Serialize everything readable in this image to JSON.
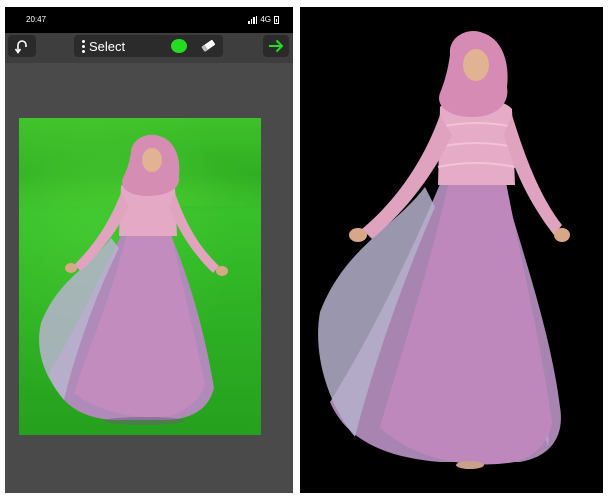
{
  "status_bar": {
    "time": "20:47",
    "network": "4G"
  },
  "toolbar": {
    "mode_label": "Select",
    "brush_color": "#22dd22"
  },
  "icons": [
    "undo-icon",
    "more-vert-icon",
    "eraser-icon",
    "arrow-right-icon"
  ],
  "colors": {
    "accent": "#22dd22",
    "app_bg": "#4a4a4a",
    "preview_bg": "#000000"
  }
}
